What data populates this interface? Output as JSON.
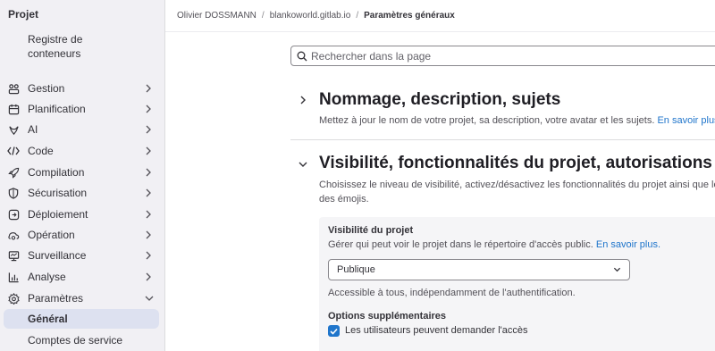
{
  "sidebar": {
    "title": "Projet",
    "registry": "Registre de conteneurs",
    "items": [
      {
        "label": "Gestion",
        "icon": "briefcase-icon"
      },
      {
        "label": "Planification",
        "icon": "calendar-icon"
      },
      {
        "label": "AI",
        "icon": "tanuki-ai-icon"
      },
      {
        "label": "Code",
        "icon": "code-icon"
      },
      {
        "label": "Compilation",
        "icon": "rocket-icon"
      },
      {
        "label": "Sécurisation",
        "icon": "shield-icon"
      },
      {
        "label": "Déploiement",
        "icon": "deployments-icon"
      },
      {
        "label": "Opération",
        "icon": "cloud-gear-icon"
      },
      {
        "label": "Surveillance",
        "icon": "monitor-icon"
      },
      {
        "label": "Analyse",
        "icon": "chart-icon"
      },
      {
        "label": "Paramètres",
        "icon": "settings-icon"
      }
    ],
    "sub_items": [
      {
        "label": "Général",
        "active": true
      },
      {
        "label": "Comptes de service",
        "active": false
      }
    ]
  },
  "breadcrumb": {
    "owner": "Olivier DOSSMANN",
    "project": "blankoworld.gitlab.io",
    "current": "Paramètres généraux",
    "separator": "/"
  },
  "search": {
    "placeholder": "Rechercher dans la page"
  },
  "sections": {
    "naming": {
      "title": "Nommage, description, sujets",
      "description": "Mettez à jour le nom de votre projet, sa description, votre avatar et les sujets.",
      "link": "En savoir plus"
    },
    "visibility": {
      "title": "Visibilité, fonctionnalités du projet, autorisations",
      "description_line1": "Choisissez le niveau de visibilité, activez/désactivez les fonctionnalités du projet ainsi que leurs autorisations, désactivez le courrier électronique et les notifications, et affichez",
      "description_line2": "des émojis."
    }
  },
  "panel": {
    "visibility_label": "Visibilité du projet",
    "visibility_help": "Gérer qui peut voir le projet dans le répertoire d'accès public.",
    "visibility_help_link": "En savoir plus.",
    "visibility_value": "Publique",
    "visibility_note": "Accessible à tous, indépendamment de l'authentification.",
    "options_label": "Options supplémentaires",
    "request_access_label": "Les utilisateurs peuvent demander l'accès",
    "request_access_checked": true
  },
  "colors": {
    "accent": "#1f75cb",
    "sidebar_bg": "#f1f0f4",
    "active_item_bg": "#dde1f0"
  }
}
